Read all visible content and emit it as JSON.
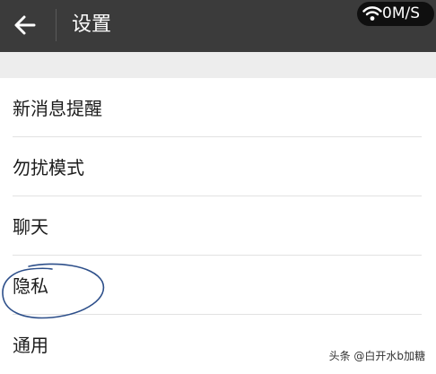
{
  "header": {
    "title": "设置",
    "back_icon": "arrow-left-icon"
  },
  "status": {
    "network_speed": "0M/S",
    "wifi_icon": "wifi-icon"
  },
  "settings": {
    "items": [
      {
        "label": "新消息提醒"
      },
      {
        "label": "勿扰模式"
      },
      {
        "label": "聊天"
      },
      {
        "label": "隐私"
      },
      {
        "label": "通用"
      }
    ]
  },
  "annotation": {
    "circled_item": "隐私",
    "color": "#2d4f8a"
  },
  "watermark": {
    "text": "头条 @白开水b加糖"
  },
  "colors": {
    "titlebar": "#3b3b3b",
    "band": "#ededed",
    "text": "#1c1c1c"
  }
}
